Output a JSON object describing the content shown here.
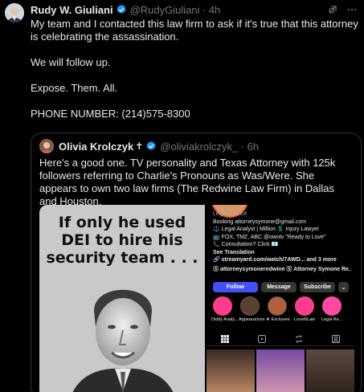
{
  "tweet": {
    "author_name": "Rudy W. Giuliani",
    "handle": "@RudyGiuliani",
    "separator": "·",
    "time": "4h",
    "lines": [
      "My team and I contacted this law firm to ask if it's true that this attorney is celebrating the assassination.",
      "We will follow up.",
      "Expose. Them. All.",
      "PHONE NUMBER: (214)575-8300"
    ]
  },
  "quote": {
    "author_name": "Olivia Krolczyk",
    "cross": "✝",
    "handle": "@oliviakrolczyk_",
    "separator": "·",
    "time": "6h",
    "text": "Here's a good one. TV personality and Texas Attorney with 125k followers referring to Charlie's Pronouns as Was/Were. She appears to own two law firms (The Redwine Law Firm) in Dallas and Houston."
  },
  "meme": {
    "text": "If only he used DEI to hire his security team . . ."
  },
  "instagram": {
    "category": "Legal Service",
    "bio": [
      "Booking attorneysymone@gmail.com",
      "⚖️ Legal Analyst | Million 💲 Injury Lawyer",
      "📺 FOX, TMZ, ABC @owntv \"Ready to Love\"",
      "📞 Consultation? Click 📧"
    ],
    "see_translation": "See Translation",
    "link": "🔗 streamyard.com/watch/7AWD... and 3 more",
    "threads": "Ⓢ attorneysymoneredwine  Ⓢ Attorney Symone Re...",
    "buttons": {
      "follow": "Follow",
      "message": "Message",
      "subscribe": "Subscribe",
      "more": "⌄"
    },
    "highlights": [
      "Diddy Analy...",
      "Appearances",
      "★ Exclusive",
      "LoveNLaw",
      "Legal Re..."
    ]
  },
  "colors": {
    "background": "#000000",
    "text": "#e7e9ea",
    "muted": "#71767b",
    "border": "#2f3336",
    "verified": "#1d9bf0",
    "ig_follow": "#4150f7"
  }
}
